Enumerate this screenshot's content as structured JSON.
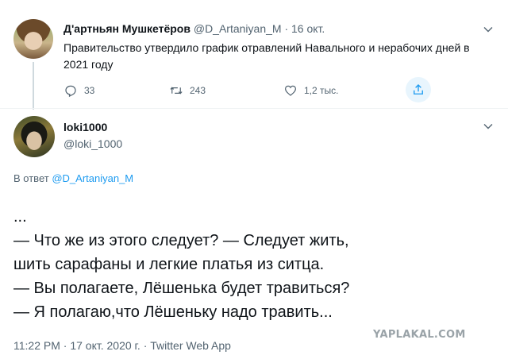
{
  "parent_tweet": {
    "author_name": "Д'артньян Мушкетёров",
    "handle": "@D_Artaniyan_M",
    "separator": "·",
    "date": "16 окт.",
    "text": "Правительство утвердило график отравлений Навального и нерабочих дней в 2021 году",
    "replies": "33",
    "retweets": "243",
    "likes": "1,2 тыс."
  },
  "main_tweet": {
    "author_name": "loki1000",
    "handle": "@loki_1000",
    "replying_prefix": "В ответ",
    "replying_to": "@D_Artaniyan_M",
    "lines": [
      "...",
      "— Что же из этого следует? — Следует жить,",
      "шить сарафаны и легкие платья из ситца.",
      "— Вы полагаете, Лёшенька будет травиться?",
      "— Я полагаю,что Лёшеньку надо травить..."
    ],
    "timestamp": "11:22 PM · 17 окт. 2020 г. · Twitter Web App"
  },
  "watermark": "YAPLAKAL.COM",
  "icons": {
    "reply": "reply-icon",
    "retweet": "retweet-icon",
    "like": "heart-icon",
    "share": "share-icon",
    "more": "chevron-down-icon"
  },
  "colors": {
    "link": "#1d9bf0",
    "secondary_text": "#536471",
    "primary_text": "#0f1419"
  }
}
